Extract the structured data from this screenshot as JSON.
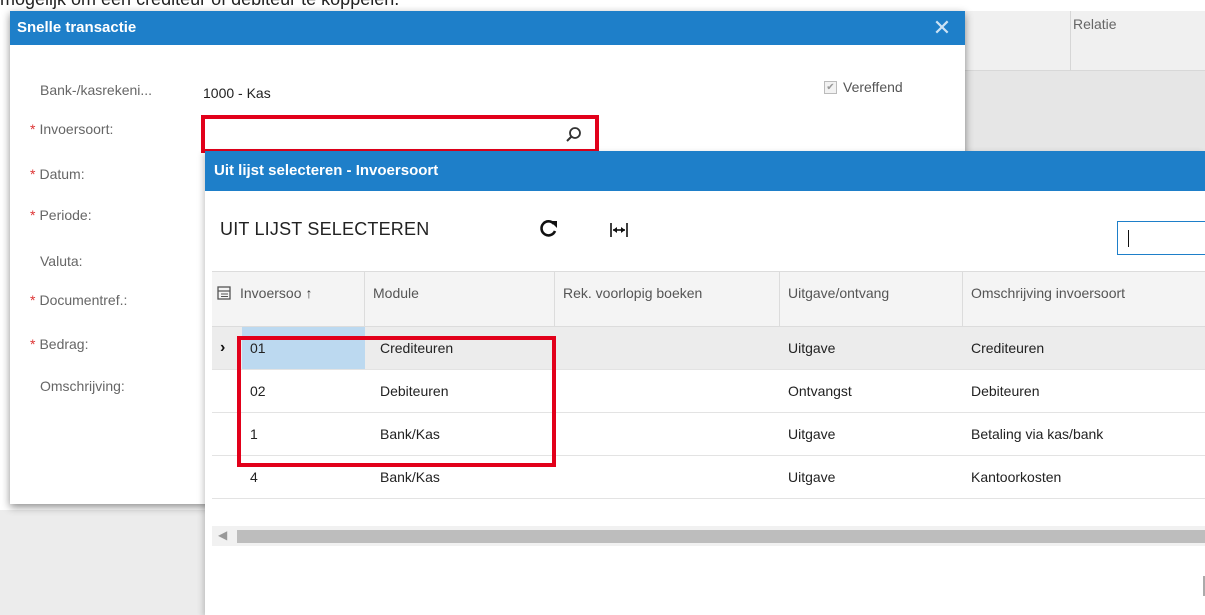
{
  "document": {
    "intro_text": "mogelijk om een crediteur of debiteur te koppelen."
  },
  "background": {
    "relatie_column": "Relatie"
  },
  "dialog": {
    "title": "Snelle transactie",
    "close_icon": "close-icon",
    "fields": {
      "bank_label": "Bank-/kasrekeni...",
      "bank_value": "1000 - Kas",
      "entry_type_label": "Invoersoort:",
      "entry_type_value": "",
      "date_label": "Datum:",
      "period_label": "Periode:",
      "currency_label": "Valuta:",
      "docref_label": "Documentref.:",
      "amount_label": "Bedrag:",
      "description_label": "Omschrijving:"
    },
    "required_marker": "*",
    "settled_checkbox": {
      "label": "Vereffend",
      "checked": true
    },
    "search_icon": "search-icon"
  },
  "lookup": {
    "title": "Uit lijst selecteren - Invoersoort",
    "toolbar": {
      "select_label": "UIT LIJST SELECTEREN",
      "refresh_icon": "refresh-icon",
      "fit_columns_icon": "fit-columns-icon"
    },
    "filter_value": "",
    "columns": [
      {
        "key": "code",
        "label": "Invoersoo"
      },
      {
        "key": "module",
        "label": "Module"
      },
      {
        "key": "provisional",
        "label": "Rek. voorlopig boeken"
      },
      {
        "key": "direction",
        "label": "Uitgave/ontvang"
      },
      {
        "key": "description",
        "label": "Omschrijving invoersoort"
      }
    ],
    "sort_indicator": "↑",
    "rows": [
      {
        "code": "01",
        "module": "Crediteuren",
        "provisional": "",
        "direction": "Uitgave",
        "description": "Crediteuren",
        "selected": true
      },
      {
        "code": "02",
        "module": "Debiteuren",
        "provisional": "",
        "direction": "Ontvangst",
        "description": "Debiteuren",
        "selected": false
      },
      {
        "code": "1",
        "module": "Bank/Kas",
        "provisional": "",
        "direction": "Uitgave",
        "description": "Betaling via kas/bank",
        "selected": false
      },
      {
        "code": "4",
        "module": "Bank/Kas",
        "provisional": "",
        "direction": "Uitgave",
        "description": "Kantoorkosten",
        "selected": false
      }
    ],
    "row_pointer": "›"
  },
  "colors": {
    "header_blue": "#1e7fc9",
    "highlight_red": "#e2001a",
    "selected_cell": "#bcd9f0",
    "required_star": "#dd3333"
  }
}
